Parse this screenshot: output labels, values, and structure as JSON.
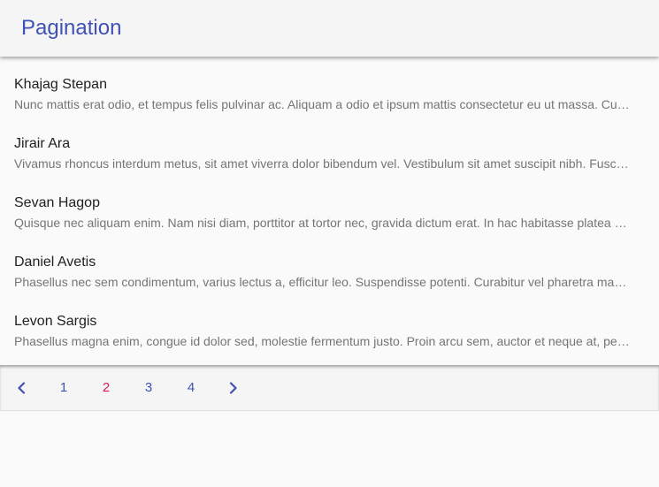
{
  "header": {
    "title": "Pagination"
  },
  "list": {
    "items": [
      {
        "name": "Khajag Stepan",
        "description": "Nunc mattis erat odio, et tempus felis pulvinar ac. Aliquam a odio et ipsum mattis consectetur eu ut massa. Curabitur vel pharetra mauris."
      },
      {
        "name": "Jirair Ara",
        "description": "Vivamus rhoncus interdum metus, sit amet viverra dolor bibendum vel. Vestibulum sit amet suscipit nibh. Fusce eu tellus et nisi."
      },
      {
        "name": "Sevan Hagop",
        "description": "Quisque nec aliquam enim. Nam nisi diam, porttitor at tortor nec, gravida dictum erat. In hac habitasse platea dictumst."
      },
      {
        "name": "Daniel Avetis",
        "description": "Phasellus nec sem condimentum, varius lectus a, efficitur leo. Suspendisse potenti. Curabitur vel pharetra mauris, in luctus orci."
      },
      {
        "name": "Levon Sargis",
        "description": "Phasellus magna enim, congue id dolor sed, molestie fermentum justo. Proin arcu sem, auctor et neque at, pellentesque luctus nisi."
      }
    ]
  },
  "pagination": {
    "prev_icon": "chevron-left-icon",
    "next_icon": "chevron-right-icon",
    "pages": [
      "1",
      "2",
      "3",
      "4"
    ],
    "current_page": "2"
  },
  "colors": {
    "accent": "#3f51b5",
    "active_page": "#d81b60",
    "header_bg": "#f5f5f5",
    "page_bg": "#fafafa"
  }
}
